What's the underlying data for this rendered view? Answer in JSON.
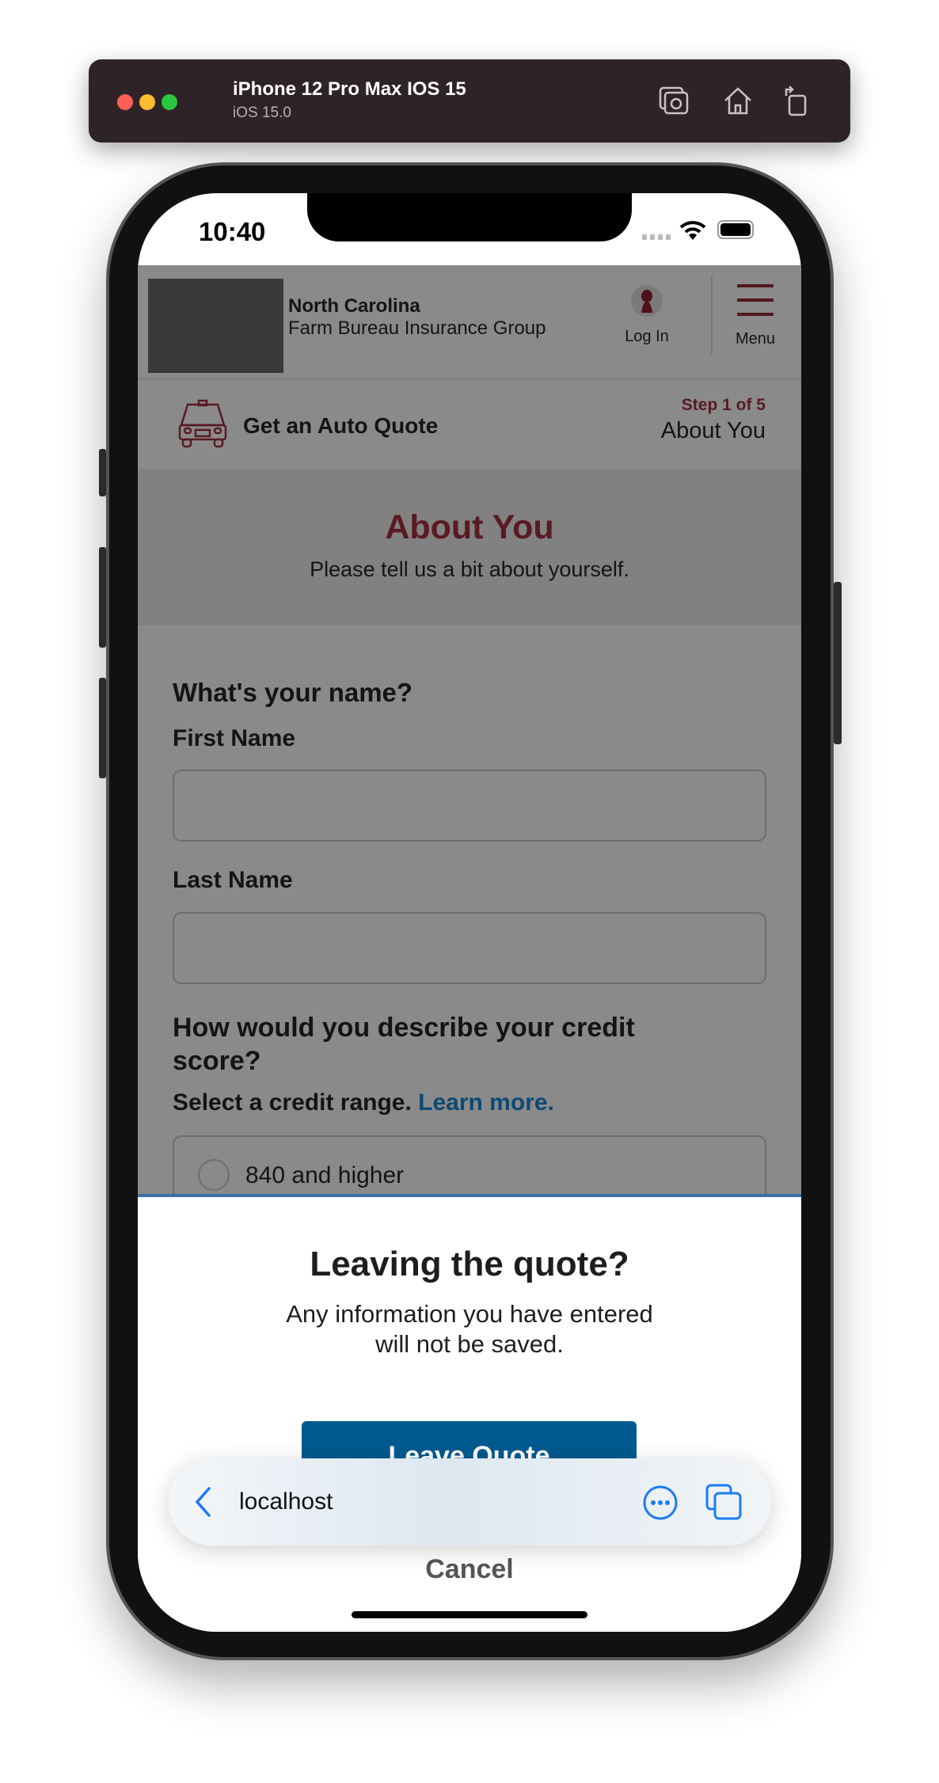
{
  "simulator": {
    "title": "iPhone 12 Pro Max IOS 15",
    "subtitle": "iOS 15.0",
    "icons": [
      "screenshot-icon",
      "home-icon",
      "rotate-icon"
    ]
  },
  "status_bar": {
    "time": "10:40"
  },
  "header": {
    "brand_line1": "North Carolina",
    "brand_line2": "Farm Bureau Insurance Group",
    "login_label": "Log In",
    "menu_label": "Menu"
  },
  "quote_bar": {
    "title": "Get an Auto Quote",
    "step": "Step 1 of 5",
    "step_name": "About You"
  },
  "section": {
    "title": "About You",
    "subtitle": "Please tell us a bit about yourself."
  },
  "form": {
    "name_question": "What's your name?",
    "first_name_label": "First Name",
    "first_name_value": "",
    "last_name_label": "Last Name",
    "last_name_value": "",
    "credit_question_line1": "How would you describe your credit",
    "credit_question_line2": "score?",
    "credit_prompt": "Select a credit range.",
    "learn_more": "Learn more.",
    "credit_options": [
      "840 and higher"
    ]
  },
  "modal": {
    "title": "Leaving the quote?",
    "body_line1": "Any information you have entered",
    "body_line2": "will not be saved.",
    "primary_button": "Leave Quote",
    "secondary_button": "Cancel"
  },
  "safari": {
    "url": "localhost"
  },
  "colors": {
    "brand_maroon": "#6b1d2a",
    "button_blue": "#005a8f",
    "link_blue": "#0b4a73",
    "safari_blue": "#1a7cf5"
  }
}
